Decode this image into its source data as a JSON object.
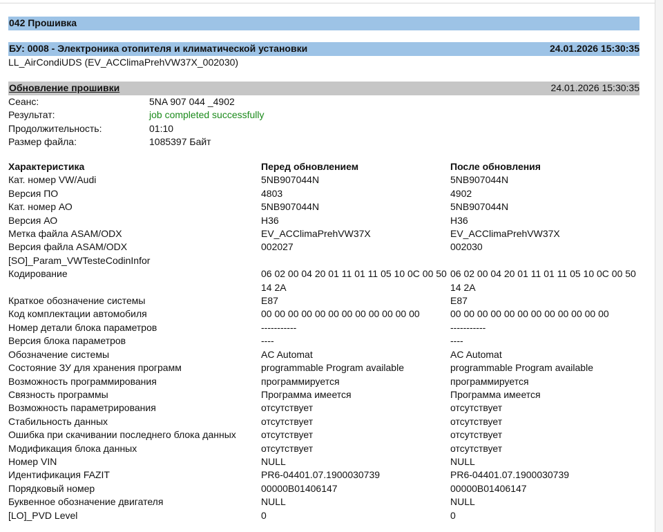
{
  "header": {
    "title": "042 Прошивка"
  },
  "ecu": {
    "title": "БУ: 0008 - Электроника отопителя и климатической установки",
    "timestamp": "24.01.2026 15:30:35",
    "dataset": "LL_AirCondiUDS (EV_ACClimaPrehVW37X_002030)"
  },
  "update": {
    "title": "Обновление прошивки",
    "timestamp": "24.01.2026 15:30:35",
    "rows": [
      {
        "label": "Сеанс:",
        "value": "5NA 907 044 _4902"
      },
      {
        "label": "Результат:",
        "value": "job completed successfully"
      },
      {
        "label": "Продолжительность:",
        "value": "01:10"
      },
      {
        "label": "Размер файла:",
        "value": "1085397 Байт"
      }
    ]
  },
  "table": {
    "headers": [
      "Характеристика",
      "Перед обновлением",
      "После обновления"
    ],
    "rows": [
      [
        "Кат. номер VW/Audi",
        "5NB907044N",
        "5NB907044N"
      ],
      [
        "Версия ПО",
        "4803",
        "4902"
      ],
      [
        "Кат. номер АО",
        "5NB907044N",
        "5NB907044N"
      ],
      [
        "Версия АО",
        "H36",
        "H36"
      ],
      [
        "Метка файла ASAM/ODX",
        "EV_ACClimaPrehVW37X",
        "EV_ACClimaPrehVW37X"
      ],
      [
        "Версия файла ASAM/ODX",
        "002027",
        "002030"
      ],
      [
        "[SO]_Param_VWTesteCodinInfor",
        "",
        ""
      ],
      [
        "Кодирование",
        "06 02 00 04 20 01 11 01 11 05 10 0C 00 50 14 2A",
        "06 02 00 04 20 01 11 01 11 05 10 0C 00 50 14 2A"
      ],
      [
        "Краткое обозначение системы",
        "E87",
        "E87"
      ],
      [
        "Код комплектации автомобиля",
        "00 00 00 00 00 00 00 00 00 00 00 00",
        "00 00 00 00 00 00 00 00 00 00 00 00"
      ],
      [
        "Номер детали блока параметров",
        "-----------",
        "-----------"
      ],
      [
        "Версия блока параметров",
        "----",
        "----"
      ],
      [
        "Обозначение системы",
        "AC Automat",
        "AC Automat"
      ],
      [
        "Состояние ЗУ для хранения программ",
        "programmable Program available",
        "programmable Program available"
      ],
      [
        "Возможность программирования",
        "программируется",
        "программируется"
      ],
      [
        "Связность программы",
        "Программа имеется",
        "Программа имеется"
      ],
      [
        "Возможность параметрирования",
        "отсутствует",
        "отсутствует"
      ],
      [
        "Стабильность данных",
        "отсутствует",
        "отсутствует"
      ],
      [
        "Ошибка при скачивании последнего блока данных",
        "отсутствует",
        "отсутствует"
      ],
      [
        "Модификация блока данных",
        "отсутствует",
        "отсутствует"
      ],
      [
        "Номер VIN",
        "NULL",
        "NULL"
      ],
      [
        "Идентификация FAZIT",
        "PR6-04401.07.1900030739",
        "PR6-04401.07.1900030739"
      ],
      [
        "Порядковый номер",
        "00000B01406147",
        "00000B01406147"
      ],
      [
        "Буквенное обозначение двигателя",
        "NULL",
        "NULL"
      ],
      [
        "[LO]_PVD Level",
        "0",
        "0"
      ]
    ]
  },
  "colors": {
    "section_bar": "#9dc3e6",
    "subsection_bar": "#c6c6c6",
    "success_text": "#1a8a1a"
  }
}
